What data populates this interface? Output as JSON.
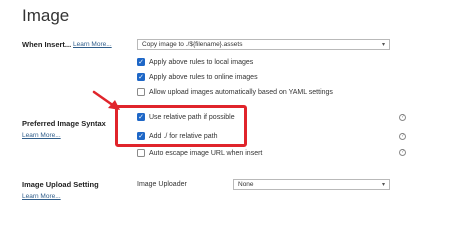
{
  "page": {
    "title": "Image"
  },
  "when_insert": {
    "label": "When Insert...",
    "learn_more": "Learn More...",
    "select_value": "Copy image to ./${filename}.assets",
    "options": [
      {
        "label": "Apply above rules to local images",
        "checked": true
      },
      {
        "label": "Apply above rules to online images",
        "checked": true
      },
      {
        "label": "Allow upload images automatically based on YAML settings",
        "checked": false
      }
    ]
  },
  "preferred_syntax": {
    "label": "Preferred Image Syntax",
    "learn_more": "Learn More...",
    "options": [
      {
        "label": "Use relative path if possible",
        "checked": true
      },
      {
        "label": "Add  ./ for relative path",
        "checked": true
      },
      {
        "label": "Auto escape image URL when insert",
        "checked": false
      }
    ]
  },
  "upload_setting": {
    "label": "Image Upload Setting",
    "learn_more": "Learn More...",
    "uploader_label": "Image Uploader",
    "uploader_value": "None"
  },
  "colors": {
    "checkbox": "#1e67c7",
    "highlight": "#e0242b",
    "link": "#2f5d8a"
  },
  "icons": {
    "help": "question-circle-icon",
    "dropdown": "chevron-down-icon",
    "arrow": "red-arrow-annotation"
  }
}
